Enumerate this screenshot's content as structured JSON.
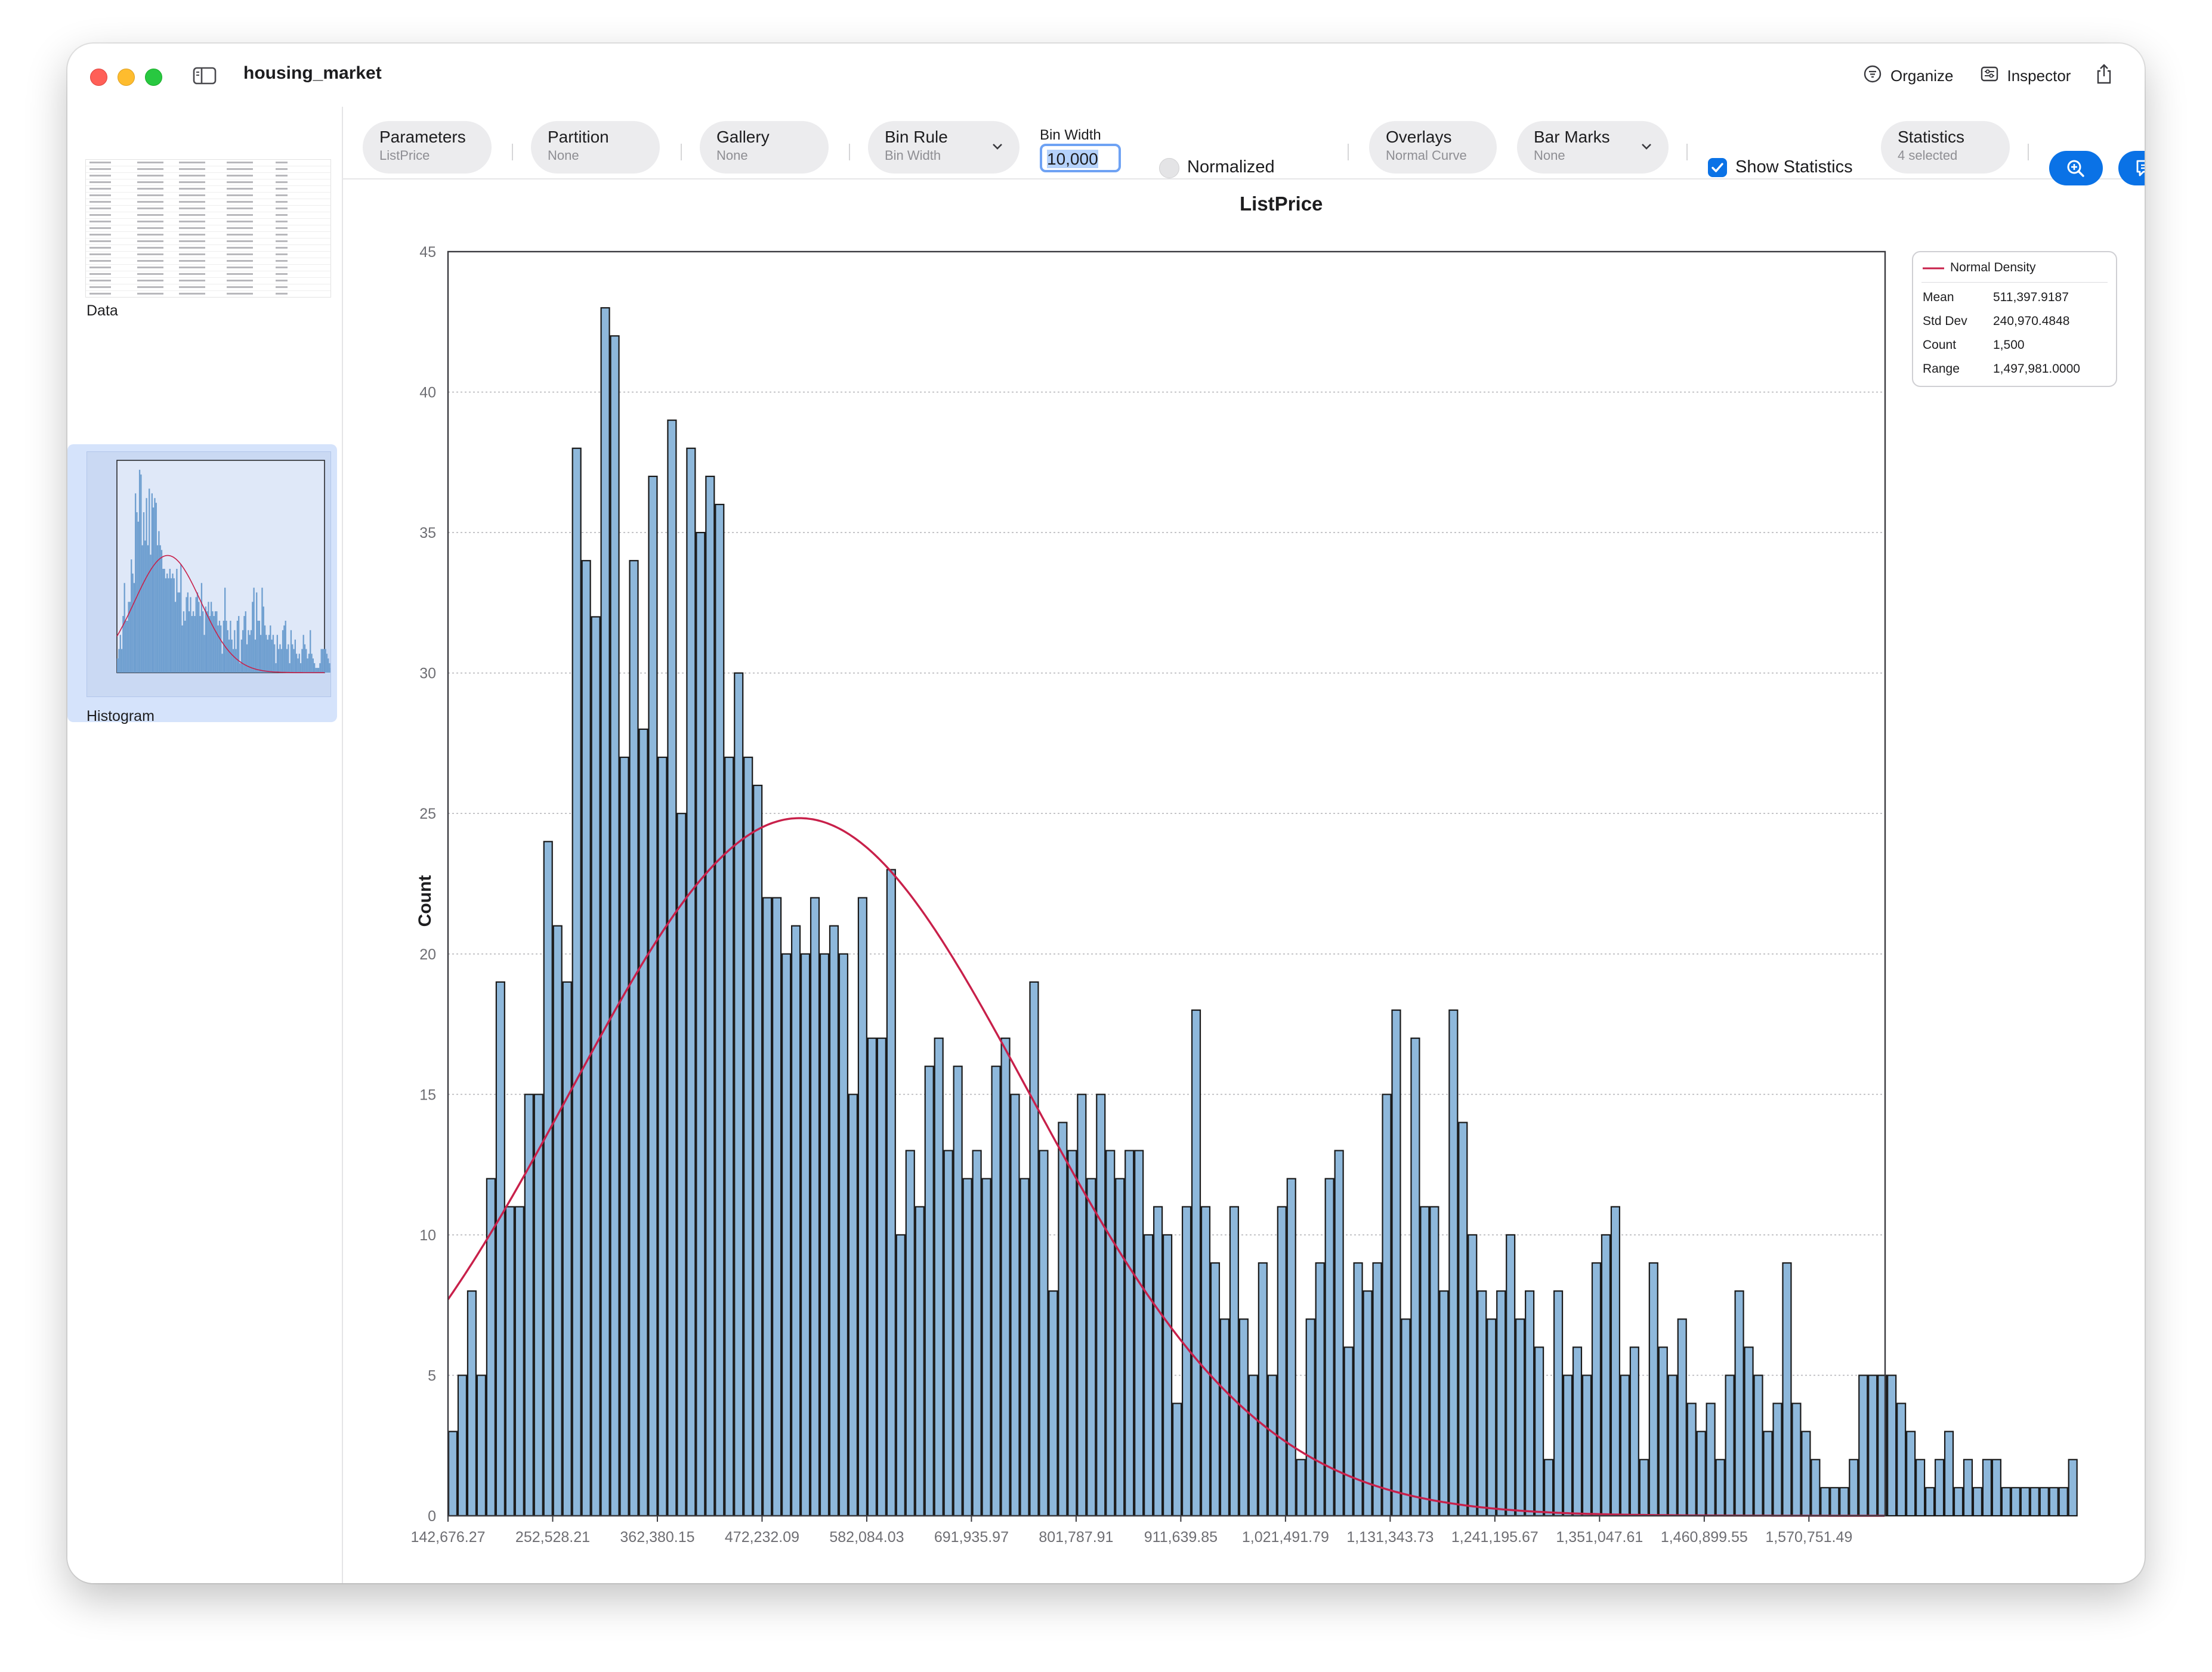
{
  "window": {
    "title": "housing_market"
  },
  "titlebar": {
    "organize_label": "Organize",
    "inspector_label": "Inspector"
  },
  "sidebar": {
    "items": [
      {
        "label": "Data"
      },
      {
        "label": "Histogram",
        "selected": true
      }
    ],
    "add_label": "+"
  },
  "toolbar": {
    "parameters": {
      "title": "Parameters",
      "value": "ListPrice"
    },
    "partition": {
      "title": "Partition",
      "value": "None"
    },
    "gallery": {
      "title": "Gallery",
      "value": "None"
    },
    "bin_rule": {
      "title": "Bin Rule",
      "value": "Bin Width"
    },
    "bin_width": {
      "label": "Bin Width",
      "value": "10,000"
    },
    "normalized": {
      "label": "Normalized",
      "checked": false
    },
    "overlays": {
      "title": "Overlays",
      "value": "Normal Curve"
    },
    "bar_marks": {
      "title": "Bar Marks",
      "value": "None"
    },
    "show_statistics": {
      "label": "Show Statistics",
      "checked": true
    },
    "statistics": {
      "title": "Statistics",
      "value": "4 selected"
    },
    "zoom_icon": "zoom-in-icon",
    "comment_icon": "comment-icon"
  },
  "legend": {
    "series_label": "Normal Density",
    "stats": [
      {
        "label": "Mean",
        "value": "511,397.9187"
      },
      {
        "label": "Std Dev",
        "value": "240,970.4848"
      },
      {
        "label": "Count",
        "value": "1,500"
      },
      {
        "label": "Range",
        "value": "1,497,981.0000"
      }
    ]
  },
  "colors": {
    "bar_fill": "#8eb8db",
    "bar_stroke": "#1a1a1a",
    "curve": "#c8204a",
    "accent": "#0a72e6"
  },
  "chart_data": {
    "type": "bar",
    "title": "ListPrice",
    "xlabel": "",
    "ylabel": "Count",
    "ylim": [
      0,
      45
    ],
    "yticks": [
      0,
      5,
      10,
      15,
      20,
      25,
      30,
      35,
      40,
      45
    ],
    "grid": "horizontal dotted",
    "xlim": [
      142676.27,
      1650676.27
    ],
    "x_tick_labels": [
      "142,676.27",
      "252,528.21",
      "362,380.15",
      "472,232.09",
      "582,084.03",
      "691,935.97",
      "801,787.91",
      "911,639.85",
      "1,021,491.79",
      "1,131,343.73",
      "1,241,195.67",
      "1,351,047.61",
      "1,460,899.55",
      "1,570,751.49"
    ],
    "bin_start": 142676.27,
    "bin_width": 10000,
    "counts": [
      3,
      5,
      8,
      5,
      12,
      19,
      11,
      11,
      15,
      15,
      24,
      21,
      19,
      38,
      34,
      32,
      43,
      42,
      27,
      34,
      28,
      37,
      27,
      39,
      25,
      38,
      35,
      37,
      36,
      27,
      30,
      27,
      26,
      22,
      22,
      20,
      21,
      20,
      22,
      20,
      21,
      20,
      15,
      22,
      17,
      17,
      23,
      10,
      13,
      11,
      16,
      17,
      13,
      16,
      12,
      13,
      12,
      16,
      17,
      15,
      12,
      19,
      13,
      8,
      14,
      13,
      15,
      12,
      15,
      13,
      12,
      13,
      13,
      10,
      11,
      10,
      4,
      11,
      18,
      11,
      9,
      7,
      11,
      7,
      5,
      9,
      5,
      11,
      12,
      2,
      7,
      9,
      12,
      13,
      6,
      9,
      8,
      9,
      15,
      18,
      7,
      17,
      11,
      11,
      8,
      18,
      14,
      10,
      8,
      7,
      8,
      10,
      7,
      8,
      6,
      2,
      8,
      5,
      6,
      5,
      9,
      10,
      11,
      5,
      6,
      2,
      9,
      6,
      5,
      7,
      4,
      3,
      4,
      2,
      5,
      8,
      6,
      5,
      3,
      4,
      9,
      4,
      3,
      2,
      1,
      1,
      1,
      2,
      5,
      5,
      5,
      5,
      4,
      3,
      2,
      1,
      2,
      3,
      1,
      2,
      1,
      2,
      2,
      1,
      1,
      1,
      1,
      1,
      1,
      1,
      2
    ],
    "bars_drawn": "see script-side exact count list",
    "normal_curve": {
      "mean": 511397.9187,
      "std": 240970.4848,
      "count": 1500
    }
  }
}
